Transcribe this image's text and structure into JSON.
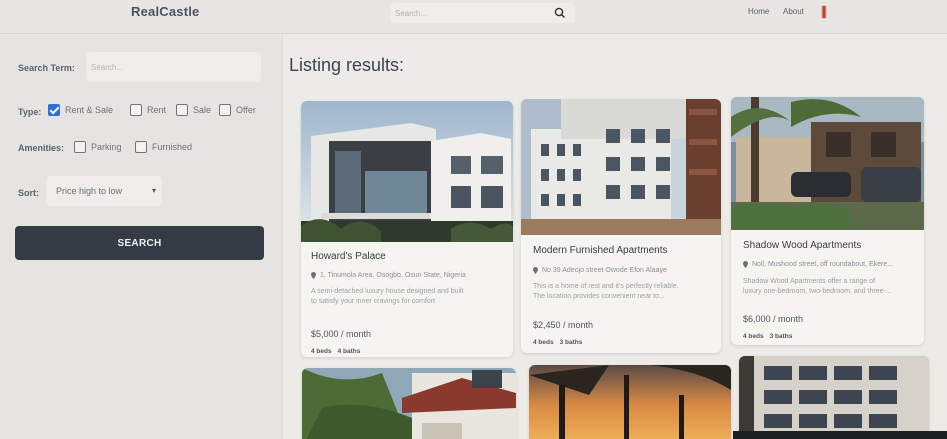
{
  "header": {
    "logo": "RealCastle",
    "search_placeholder": "Search...",
    "nav_home": "Home",
    "nav_about": "About"
  },
  "sidebar": {
    "search_term_label": "Search Term:",
    "search_term_placeholder": "Search...",
    "type_label": "Type:",
    "type_options": [
      {
        "label": "Rent & Sale",
        "checked": true
      },
      {
        "label": "Rent",
        "checked": false
      },
      {
        "label": "Sale",
        "checked": false
      },
      {
        "label": "Offer",
        "checked": false
      }
    ],
    "amenities_label": "Amenities:",
    "amenities_options": [
      {
        "label": "Parking",
        "checked": false
      },
      {
        "label": "Furnished",
        "checked": false
      }
    ],
    "sort_label": "Sort:",
    "sort_value": "Price high to low",
    "search_button": "SEARCH"
  },
  "main": {
    "title": "Listing results:",
    "listings": [
      {
        "title": "Howard's Palace",
        "address": "1, Tinumola Area, Osogbo, Osun State, Nigeria",
        "description_line1": "A semi-detached luxury house designed and built",
        "description_line2": "to satisfy your inner cravings for comfort",
        "price": "$5,000 / month",
        "beds": "4 beds",
        "baths": "4 baths"
      },
      {
        "title": "Modern Furnished Apartments",
        "address": "No 39 Adeojo street Owode Efon Alaaye",
        "description_line1": "This is a home of rest and it's perfectly reliable.",
        "description_line2": "The location provides convenient near to...",
        "price": "$2,450 / month",
        "beds": "4 beds",
        "baths": "3 baths"
      },
      {
        "title": "Shadow Wood Apartments",
        "address": "Noll, Mushood street, off roundabout, Ekere...",
        "description_line1": "Shadow Wood Apartments offer a range of",
        "description_line2": "luxury one-bedroom, two-bedroom, and three-...",
        "price": "$6,000 / month",
        "beds": "4 beds",
        "baths": "3 baths"
      }
    ]
  },
  "colors": {
    "checkbox_checked": "#2f6fd6",
    "search_button_bg": "#353b44",
    "user_icon_red": "#c0392b"
  }
}
